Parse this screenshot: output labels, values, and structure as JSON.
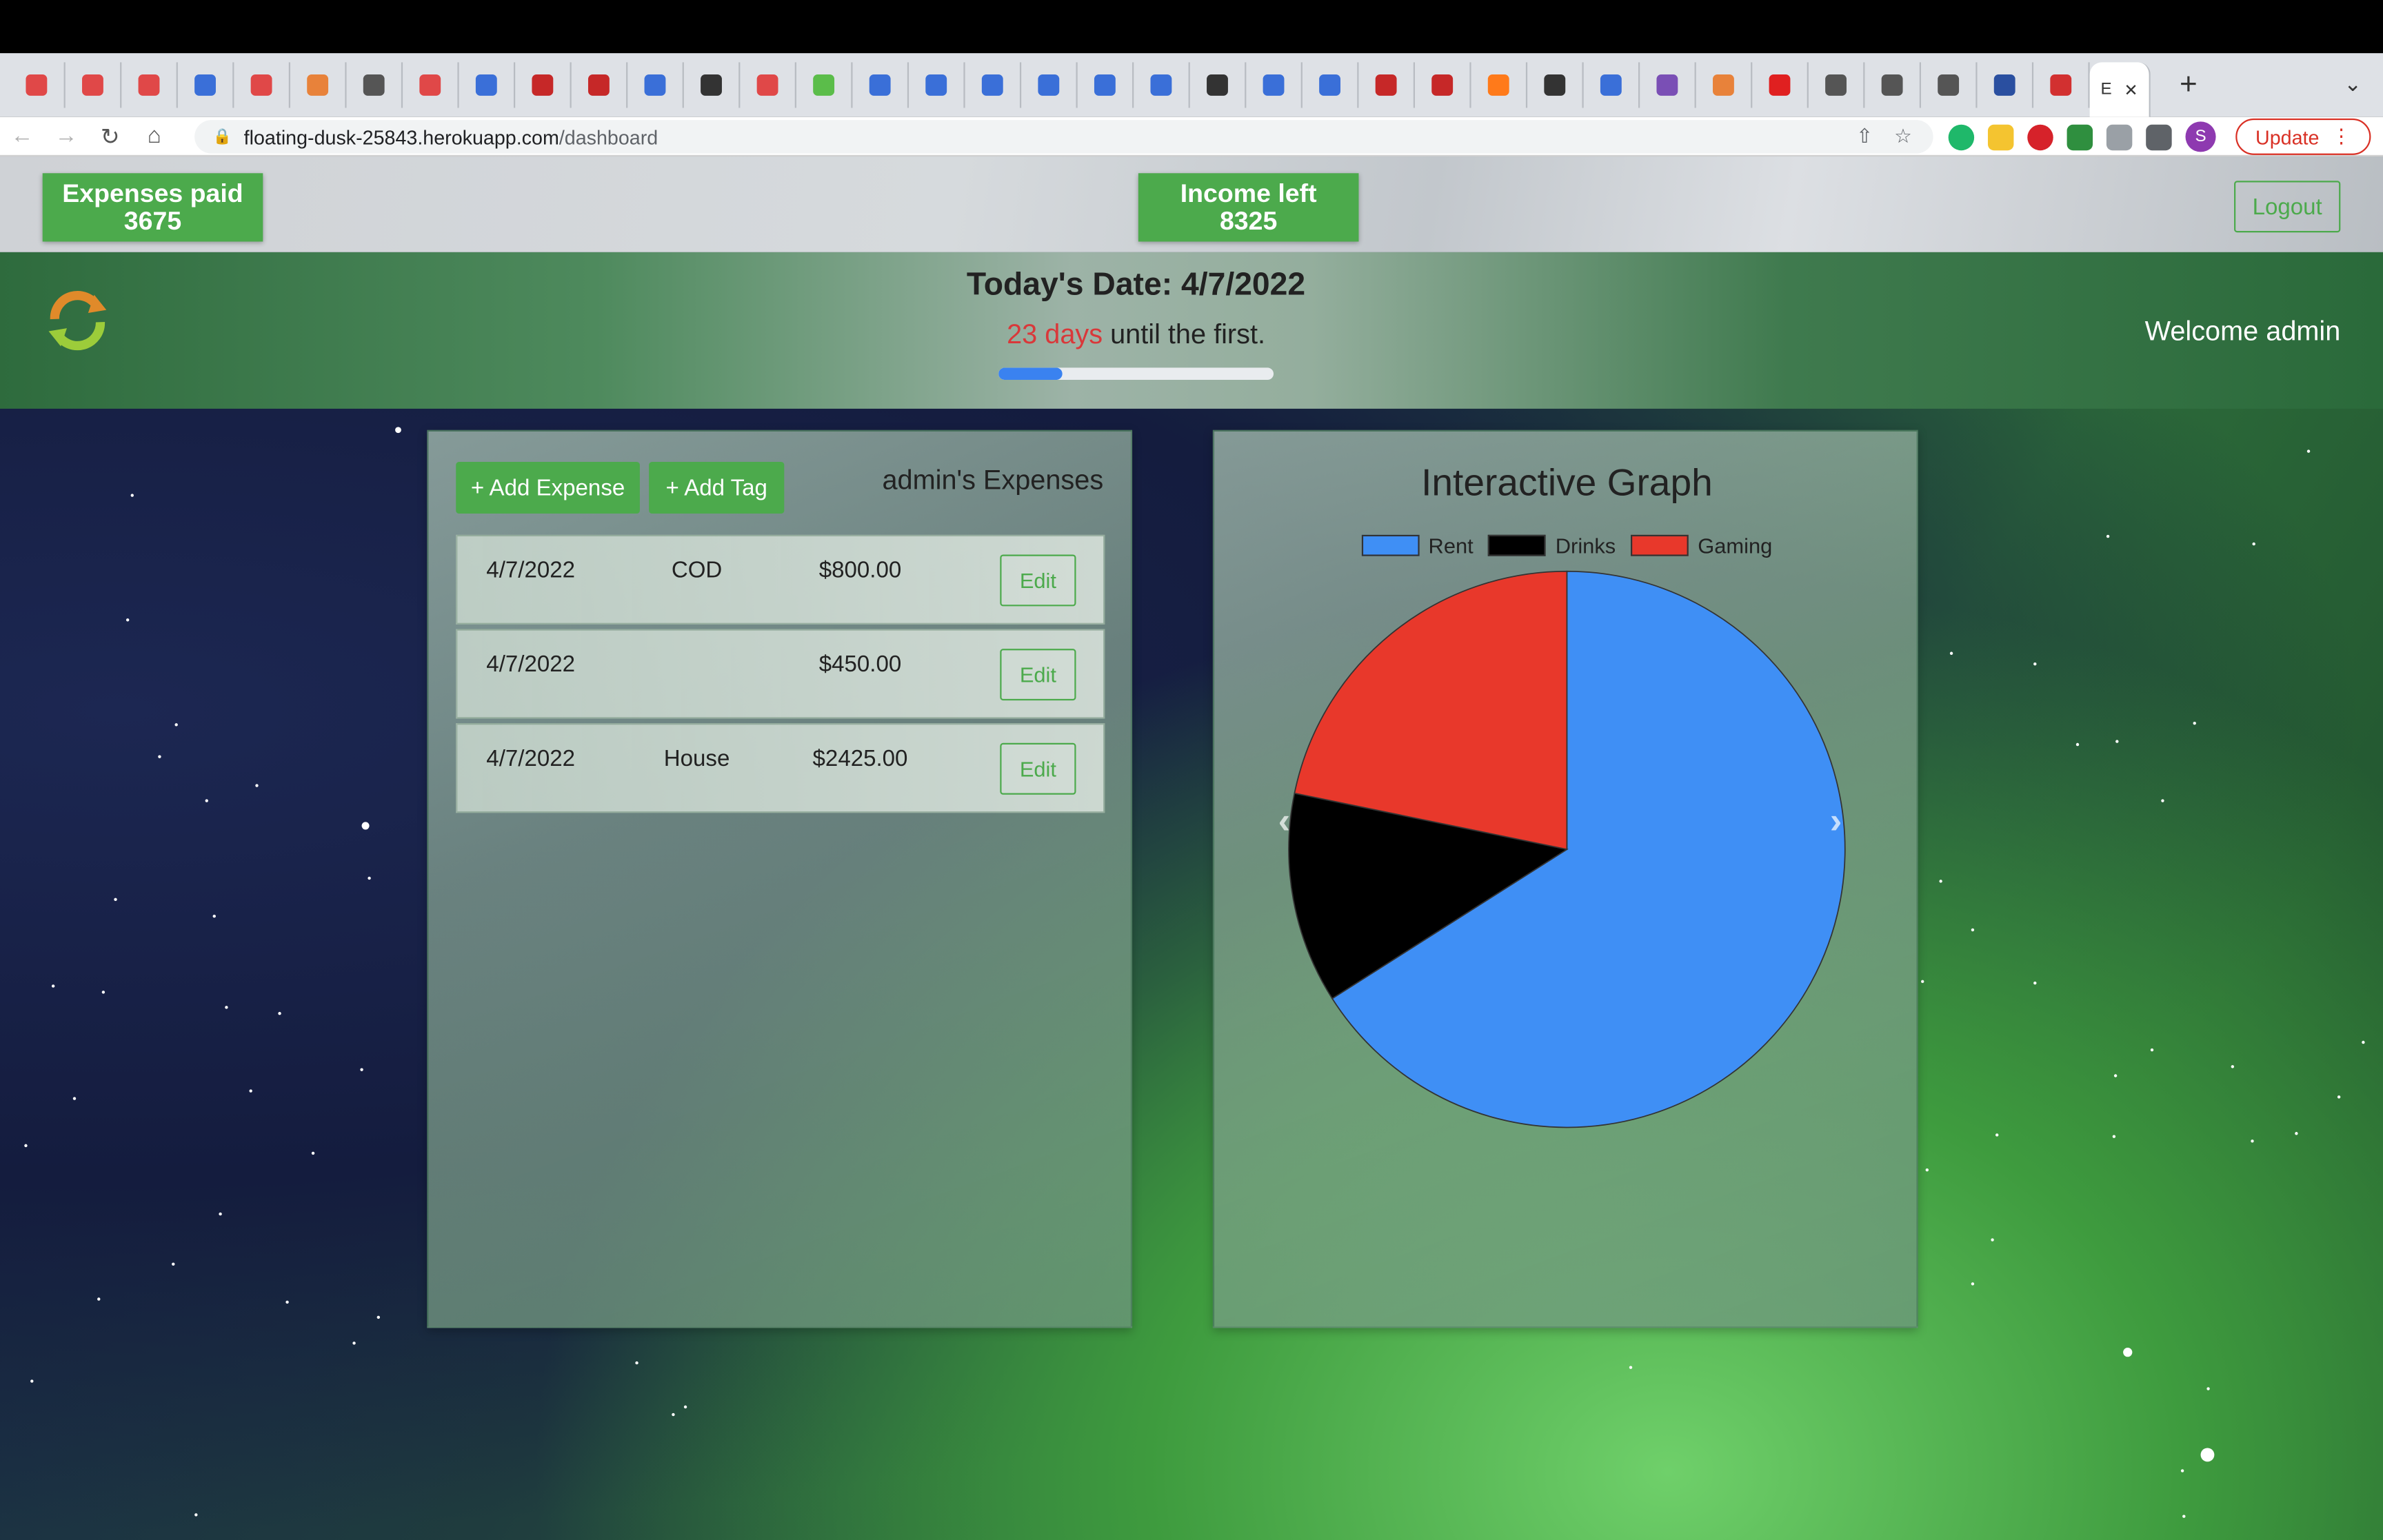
{
  "browser": {
    "url_host": "floating-dusk-25843.herokuapp.com",
    "url_path": "/dashboard",
    "active_tab_label": "E",
    "update_label": "Update",
    "profile_initial": "S"
  },
  "header": {
    "expenses_paid_label": "Expenses paid",
    "expenses_paid_value": "3675",
    "income_left_label": "Income left",
    "income_left_value": "8325",
    "logout_label": "Logout"
  },
  "banner": {
    "date_text": "Today's Date: 4/7/2022",
    "days_count": "23 days",
    "days_suffix": " until the first.",
    "progress_fraction": 0.23,
    "welcome_text": "Welcome admin"
  },
  "expenses": {
    "add_expense_label": "+ Add Expense",
    "add_tag_label": "+ Add Tag",
    "title": "admin's Expenses",
    "edit_label": "Edit",
    "rows": [
      {
        "date": "4/7/2022",
        "tag": "COD",
        "amount": "$800.00"
      },
      {
        "date": "4/7/2022",
        "tag": "",
        "amount": "$450.00"
      },
      {
        "date": "4/7/2022",
        "tag": "House",
        "amount": "$2425.00"
      }
    ]
  },
  "graph": {
    "title": "Interactive Graph",
    "prev_icon": "chevron-left-icon",
    "next_icon": "chevron-right-icon"
  },
  "chart_data": {
    "type": "pie",
    "title": "Interactive Graph",
    "labels": [
      "Rent",
      "Drinks",
      "Gaming"
    ],
    "values": [
      2425,
      450,
      800
    ],
    "colors": [
      "#3f8ff5",
      "#000000",
      "#e8382b"
    ],
    "legend": "top"
  }
}
